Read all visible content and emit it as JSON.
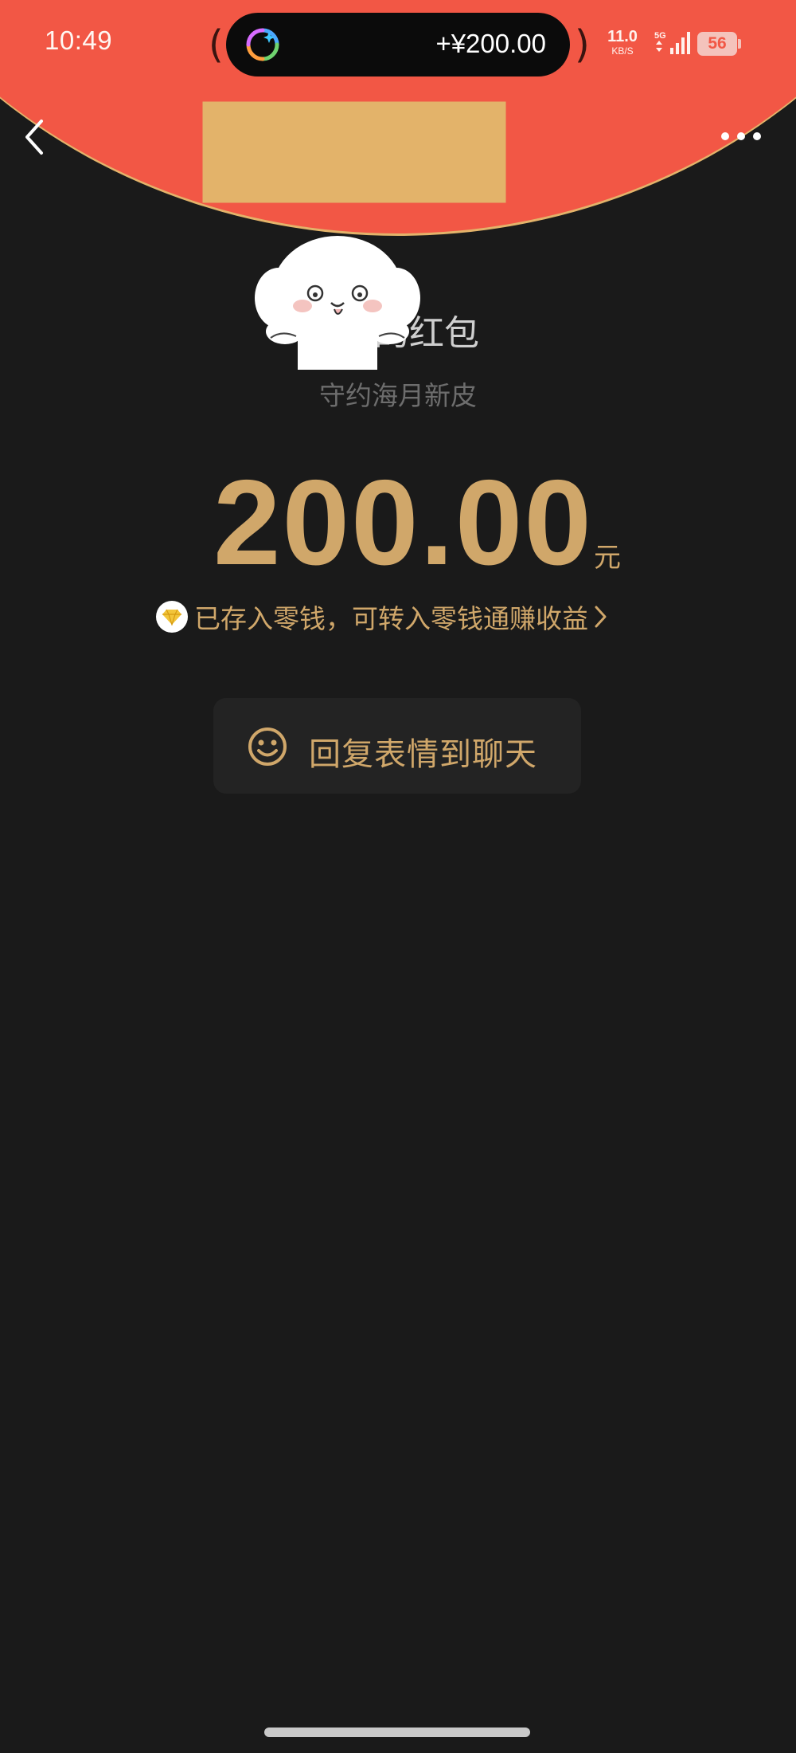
{
  "status_bar": {
    "time": "10:49",
    "island_amount": "+¥200.00",
    "net_speed_value": "11.0",
    "net_speed_unit": "KB/S",
    "network_type": "5G",
    "battery": "56"
  },
  "nav": {
    "back_icon": "chevron-left-icon",
    "more_icon": "more-horizontal-icon"
  },
  "envelope": {
    "title_visible": "的红包",
    "subtitle": "守约海月新皮",
    "amount": "200.00",
    "unit": "元",
    "note": "已存入零钱，可转入零钱通赚收益",
    "reply_label": "回复表情到聊天"
  },
  "colors": {
    "header_red": "#f25745",
    "gold": "#d0a76a",
    "background": "#1a1a1a",
    "button_bg": "#232323"
  }
}
